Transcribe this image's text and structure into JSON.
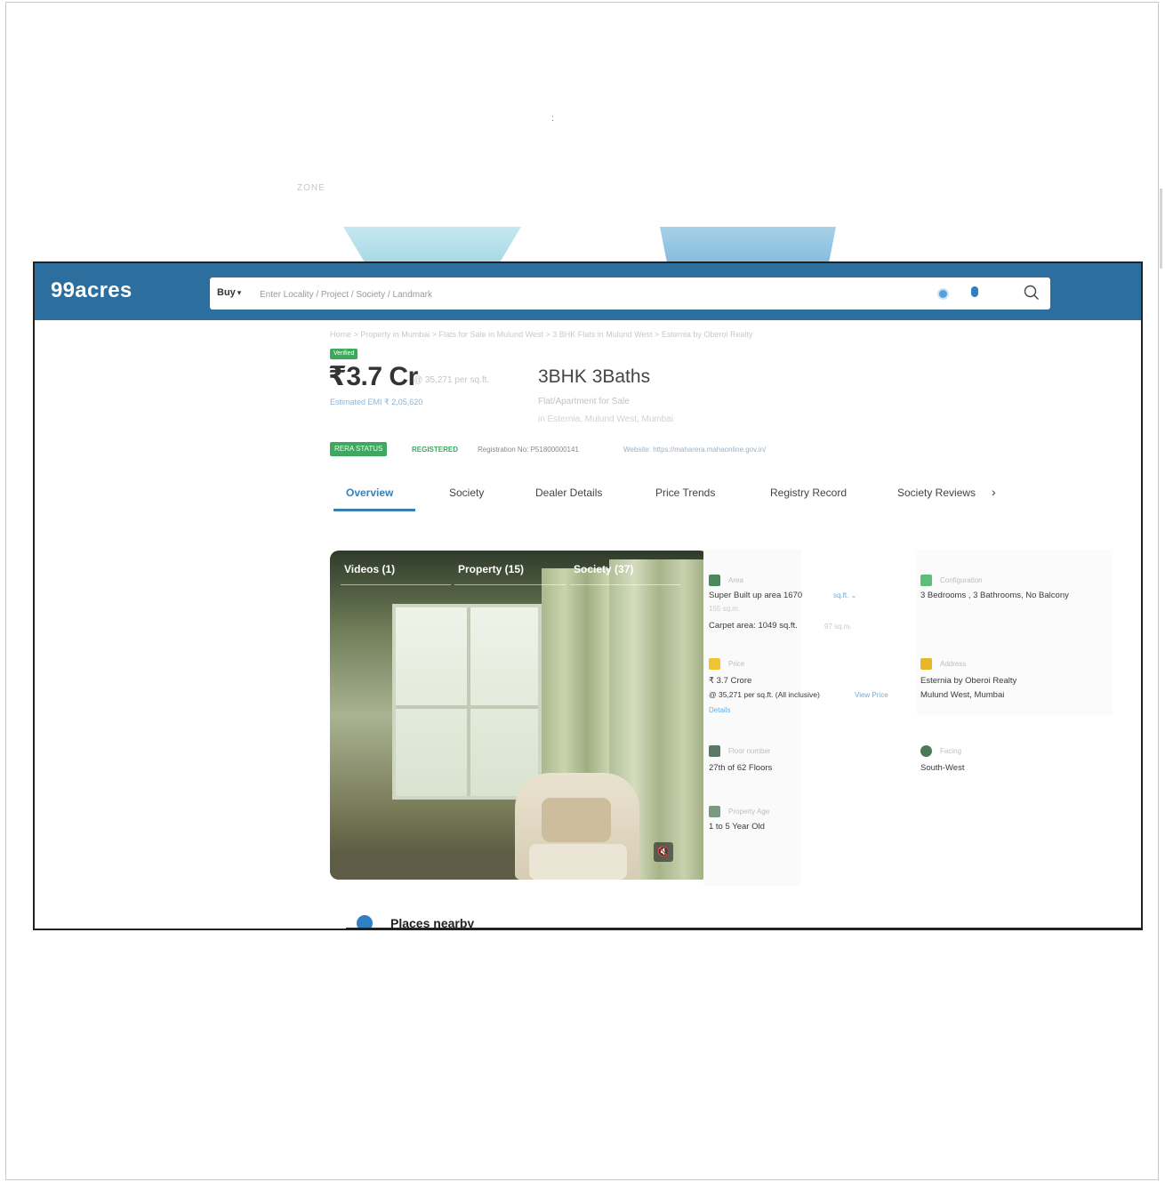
{
  "outer": {
    "top_dot": ":",
    "faint_text": "ZONE"
  },
  "header": {
    "logo": "99acres",
    "search_type": "Buy",
    "search_placeholder": "Enter Locality / Project / Society / Landmark"
  },
  "breadcrumb": "Home > Property in Mumbai > Flats for Sale in Mulund West > 3 BHK Flats in Mulund West > Esternia by Oberoi Realty",
  "listing": {
    "verified": "Verified",
    "price": "₹3.7 Cr",
    "price_per_sqft": "@ 35,271 per sq.ft.",
    "emi": "Estimated EMI ₹ 2,05,620",
    "title": "3BHK 3Baths",
    "subtype": "Flat/Apartment for Sale",
    "address": "in Esternia, Mulund West, Mumbai",
    "rera_status": "RERA STATUS",
    "rera_registered": "REGISTERED",
    "rera_reg_no": "Registration No: P51800000141",
    "rera_website": "Website: https://maharera.mahaonline.gov.in/"
  },
  "tabs": [
    "Overview",
    "Society",
    "Dealer Details",
    "Price Trends",
    "Registry Record",
    "Society Reviews"
  ],
  "tab_next": "›",
  "gallery": {
    "tabs": [
      "Videos (1)",
      "Property (15)",
      "Society (37)"
    ],
    "mute": "🔇"
  },
  "details": {
    "area_label": "Area",
    "super_area": "Super Built up area 1670",
    "area_unit": "sq.ft.",
    "super_area_sub": "155 sq.m.",
    "carpet_area": "Carpet area: 1049 sq.ft.",
    "carpet_area_sub": "97 sq.m.",
    "config_label": "Configuration",
    "config_value": "3 Bedrooms , 3 Bathrooms, No Balcony",
    "price_label": "Price",
    "price_value": "₹ 3.7 Crore",
    "price_per": "@ 35,271 per sq.ft. (All inclusive)",
    "view_price": "View Price",
    "details_link": "Details",
    "address_label": "Address",
    "address_line1": "Esternia by Oberoi Realty",
    "address_line2": "Mulund West, Mumbai",
    "floor_label": "Floor number",
    "floor_value": "27th of 62 Floors",
    "facing_label": "Facing",
    "facing_value": "South-West",
    "age_label": "Property Age",
    "age_value": "1 to 5 Year Old"
  },
  "places_nearby": "Places nearby",
  "colors": {
    "header": "#2c6e9e",
    "accent": "#3a7fb4",
    "rera_green": "#3ea860"
  }
}
